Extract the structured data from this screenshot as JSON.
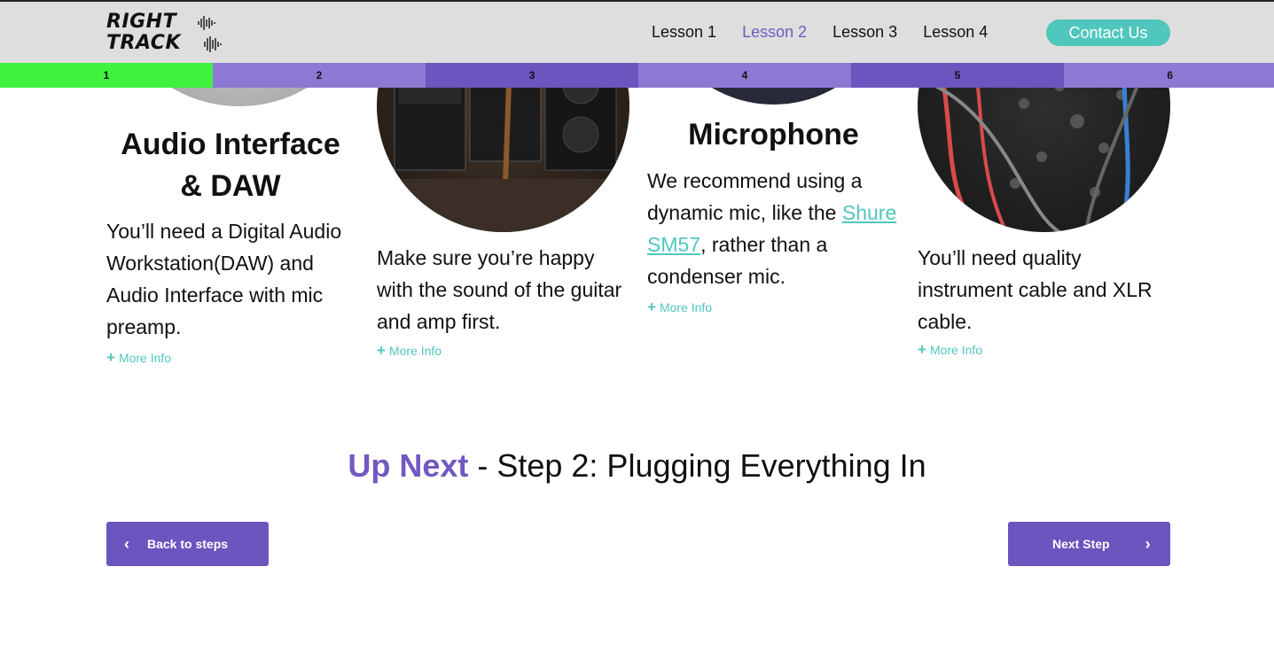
{
  "header": {
    "logo_line1": "RIGHT",
    "logo_line2": "TRACK",
    "nav": [
      {
        "label": "Lesson 1",
        "active": false
      },
      {
        "label": "Lesson 2",
        "active": true
      },
      {
        "label": "Lesson 3",
        "active": false
      },
      {
        "label": "Lesson 4",
        "active": false
      }
    ],
    "contact_label": "Contact Us"
  },
  "progress": {
    "steps": [
      "1",
      "2",
      "3",
      "4",
      "5",
      "6"
    ],
    "current_step": 1,
    "colors": {
      "done": "#3ef23e",
      "light": "#8b79d4",
      "dark": "#6b55bf"
    }
  },
  "cards": [
    {
      "title_line1": "Audio Interface",
      "title_line2": "& DAW",
      "text": "You’ll need a Digital Audio Workstation(DAW) and Audio Interface with mic preamp.",
      "more": "More Info"
    },
    {
      "text": "Make sure you’re happy with the sound of the guitar and amp first.",
      "more": "More Info"
    },
    {
      "title": "Microphone",
      "text_before": "We recommend using a dynamic mic, like the ",
      "link": "Shure SM57",
      "text_after": ", rather than a condenser mic.",
      "more": "More Info"
    },
    {
      "text": "You’ll need quality instrument cable and XLR cable.",
      "more": "More Info"
    }
  ],
  "upnext": {
    "highlight": "Up Next",
    "rest": " - Step 2: Plugging Everything In"
  },
  "buttons": {
    "back": "Back to steps",
    "next": "Next Step"
  },
  "colors": {
    "accent_purple": "#7159c1",
    "accent_teal": "#4fc7bd"
  }
}
